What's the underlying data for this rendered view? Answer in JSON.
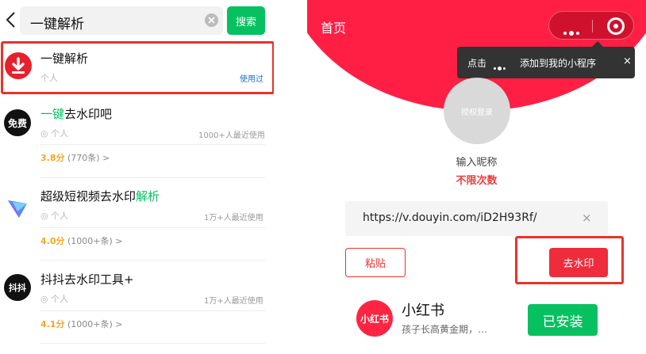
{
  "search": {
    "query": "一键解析",
    "button_label": "搜索"
  },
  "results": [
    {
      "title": "一键解析",
      "title_plain": "一键解析",
      "title_green": "",
      "owner": "个人",
      "used_label": "使用过",
      "users": "",
      "score": "",
      "score_count": ""
    },
    {
      "title_green": "一键",
      "title_plain": "去水印吧",
      "owner": "个人",
      "users": "1000+人最近使用",
      "score": "3.8分",
      "score_count": "(770条) >",
      "avatar_text": "免费"
    },
    {
      "title_plain": "超级短视频去水印",
      "title_green": "解析",
      "owner": "个人",
      "users": "1万+人最近使用",
      "score": "4.0分",
      "score_count": "(1000+条) >"
    },
    {
      "title_plain": "抖抖去水印工具+",
      "owner": "个人",
      "users": "1万+人最近使用",
      "score": "4.1分",
      "score_count": "(1000+条) >",
      "avatar_text": "抖抖"
    }
  ],
  "miniapp": {
    "title": "首页",
    "tip_prefix": "点击",
    "tip_suffix": "添加到我的小程序",
    "tip_close": "×",
    "login_label": "授权登录",
    "nickname": "输入昵称",
    "unlimited": "不限次数",
    "url_value": "https://v.douyin.com/iD2H93Rf/",
    "url_clear": "×",
    "paste_label": "粘贴",
    "remove_label": "去水印",
    "ad": {
      "logo_text": "小红书",
      "name": "小红书",
      "desc": "孩子长高黄金期，…",
      "button_label": "已安装"
    }
  },
  "colors": {
    "wechat_green": "#07c160",
    "brand_red": "#ff1f44",
    "highlight_red": "#e8332a",
    "rating_gold": "#f5a623",
    "link_blue": "#1b6fd6"
  },
  "icons": [
    "chevron-left-icon",
    "clear-icon",
    "download-icon",
    "more-dots-icon",
    "target-icon"
  ]
}
